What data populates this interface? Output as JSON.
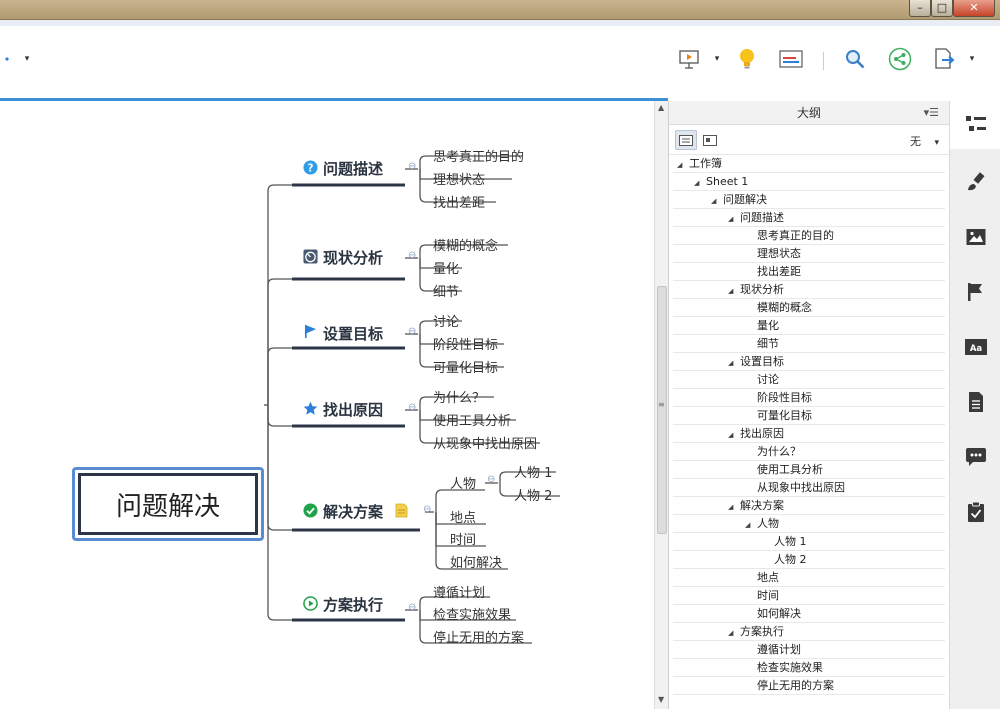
{
  "window": {
    "min": "–",
    "max": "□",
    "close": "✕"
  },
  "toolbar": {
    "items": [
      "presentation-icon",
      "idea-icon",
      "layout-icon",
      "search-icon",
      "share-icon",
      "export-icon"
    ],
    "caret": "▾"
  },
  "map": {
    "central": "问题解决",
    "branches": [
      {
        "label": "问题描述",
        "icon": "question-icon",
        "children": [
          "思考真正的目的",
          "理想状态",
          "找出差距"
        ]
      },
      {
        "label": "现状分析",
        "icon": "gauge-icon",
        "children": [
          "模糊的概念",
          "量化",
          "细节"
        ]
      },
      {
        "label": "设置目标",
        "icon": "flag-icon",
        "children": [
          "讨论",
          "阶段性目标",
          "可量化目标"
        ]
      },
      {
        "label": "找出原因",
        "icon": "star-icon",
        "children": [
          "为什么？",
          "使用工具分析",
          "从现象中找出原因"
        ]
      },
      {
        "label": "解决方案",
        "icon": "check-icon",
        "note": "note-icon",
        "children": [
          "人物",
          "地点",
          "时间",
          "如何解决"
        ],
        "sub": [
          "人物 1",
          "人物 2"
        ]
      },
      {
        "label": "方案执行",
        "icon": "play-icon",
        "children": [
          "遵循计划",
          "检查实施效果",
          "停止无用的方案"
        ]
      }
    ],
    "collapse": "⊖"
  },
  "outline": {
    "title": "大纲",
    "filter": "无",
    "rows": [
      {
        "text": "工作簿",
        "level": 0,
        "tri": "◢"
      },
      {
        "text": "Sheet 1",
        "level": 1,
        "tri": "◢"
      },
      {
        "text": "问题解决",
        "level": 2,
        "tri": "◢"
      },
      {
        "text": "问题描述",
        "level": 3,
        "tri": "◢"
      },
      {
        "text": "思考真正的目的",
        "level": 4,
        "tri": ""
      },
      {
        "text": "理想状态",
        "level": 4,
        "tri": ""
      },
      {
        "text": "找出差距",
        "level": 4,
        "tri": ""
      },
      {
        "text": "现状分析",
        "level": 3,
        "tri": "◢"
      },
      {
        "text": "模糊的概念",
        "level": 4,
        "tri": ""
      },
      {
        "text": "量化",
        "level": 4,
        "tri": ""
      },
      {
        "text": "细节",
        "level": 4,
        "tri": ""
      },
      {
        "text": "设置目标",
        "level": 3,
        "tri": "◢"
      },
      {
        "text": "讨论",
        "level": 4,
        "tri": ""
      },
      {
        "text": "阶段性目标",
        "level": 4,
        "tri": ""
      },
      {
        "text": "可量化目标",
        "level": 4,
        "tri": ""
      },
      {
        "text": "找出原因",
        "level": 3,
        "tri": "◢"
      },
      {
        "text": "为什么？",
        "level": 4,
        "tri": ""
      },
      {
        "text": "使用工具分析",
        "level": 4,
        "tri": ""
      },
      {
        "text": "从现象中找出原因",
        "level": 4,
        "tri": ""
      },
      {
        "text": "解决方案",
        "level": 3,
        "tri": "◢"
      },
      {
        "text": "人物",
        "level": 4,
        "tri": "◢"
      },
      {
        "text": "人物 1",
        "level": 5,
        "tri": ""
      },
      {
        "text": "人物 2",
        "level": 5,
        "tri": ""
      },
      {
        "text": "地点",
        "level": 4,
        "tri": ""
      },
      {
        "text": "时间",
        "level": 4,
        "tri": ""
      },
      {
        "text": "如何解决",
        "level": 4,
        "tri": ""
      },
      {
        "text": "方案执行",
        "level": 3,
        "tri": "◢"
      },
      {
        "text": "遵循计划",
        "level": 4,
        "tri": ""
      },
      {
        "text": "检查实施效果",
        "level": 4,
        "tri": ""
      },
      {
        "text": "停止无用的方案",
        "level": 4,
        "tri": ""
      }
    ]
  },
  "rail": [
    "outline-icon",
    "format-brush-icon",
    "image-icon",
    "marker-flag-icon",
    "text-style-icon",
    "notes-icon",
    "comment-icon",
    "task-icon"
  ],
  "colors": {
    "accent": "#3d8fd6",
    "branch_line": "#2c3646",
    "connector": "#555555",
    "icon_blue": "#2f7fd8",
    "icon_green": "#1fa24a"
  }
}
